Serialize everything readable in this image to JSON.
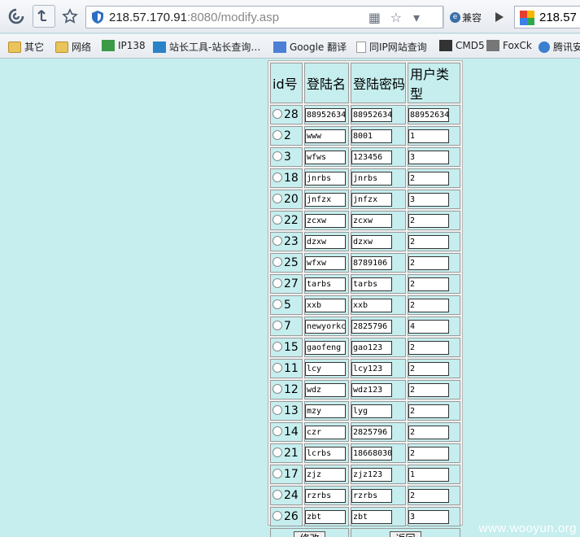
{
  "browser": {
    "address_host": "218.57.170.91",
    "address_rest": ":8080/modify.asp",
    "compat_label": "兼容",
    "search_text": "218.57",
    "bookmarks": [
      {
        "label": "其它",
        "icon": "folder-icon"
      },
      {
        "label": "网络",
        "icon": "folder-icon"
      },
      {
        "label": "IP138",
        "icon": "ip138-icon"
      },
      {
        "label": "站长工具-站长查询…",
        "icon": "chinaz-icon"
      },
      {
        "label": "Google 翻译",
        "icon": "google-translate-icon"
      },
      {
        "label": "同IP网站查询",
        "icon": "page-icon"
      },
      {
        "label": "CMD5",
        "icon": "cmd5-icon"
      },
      {
        "label": "FoxCk",
        "icon": "foxck-icon"
      },
      {
        "label": "腾讯安",
        "icon": "tencent-icon"
      }
    ]
  },
  "table": {
    "headers": [
      "id号",
      "登陆名",
      "登陆密码",
      "用户类型"
    ],
    "rows": [
      {
        "id": "28",
        "name": "88952634",
        "password": "88952634",
        "type": "88952634"
      },
      {
        "id": "2",
        "name": "www",
        "password": "8001",
        "type": "1"
      },
      {
        "id": "3",
        "name": "wfws",
        "password": "123456",
        "type": "3"
      },
      {
        "id": "18",
        "name": "jnrbs",
        "password": "jnrbs",
        "type": "2"
      },
      {
        "id": "20",
        "name": "jnfzx",
        "password": "jnfzx",
        "type": "3"
      },
      {
        "id": "22",
        "name": "zcxw",
        "password": "zcxw",
        "type": "2"
      },
      {
        "id": "23",
        "name": "dzxw",
        "password": "dzxw",
        "type": "2"
      },
      {
        "id": "25",
        "name": "wfxw",
        "password": "8789106",
        "type": "2"
      },
      {
        "id": "27",
        "name": "tarbs",
        "password": "tarbs",
        "type": "2"
      },
      {
        "id": "5",
        "name": "xxb",
        "password": "xxb",
        "type": "2"
      },
      {
        "id": "7",
        "name": "newyorkc",
        "password": "2825796",
        "type": "4"
      },
      {
        "id": "15",
        "name": "gaofeng",
        "password": "gao123",
        "type": "2"
      },
      {
        "id": "11",
        "name": "lcy",
        "password": "lcy123",
        "type": "2"
      },
      {
        "id": "12",
        "name": "wdz",
        "password": "wdz123",
        "type": "2"
      },
      {
        "id": "13",
        "name": "mzy",
        "password": "lyg",
        "type": "2"
      },
      {
        "id": "14",
        "name": "czr",
        "password": "2825796",
        "type": "2"
      },
      {
        "id": "21",
        "name": "lcrbs",
        "password": "18668030",
        "type": "2"
      },
      {
        "id": "17",
        "name": "zjz",
        "password": "zjz123",
        "type": "1"
      },
      {
        "id": "24",
        "name": "rzrbs",
        "password": "rzrbs",
        "type": "2"
      },
      {
        "id": "26",
        "name": "zbt",
        "password": "zbt",
        "type": "3"
      }
    ],
    "modify_label": "修改",
    "back_label": "返回"
  },
  "watermark": "www.wooyun.org"
}
